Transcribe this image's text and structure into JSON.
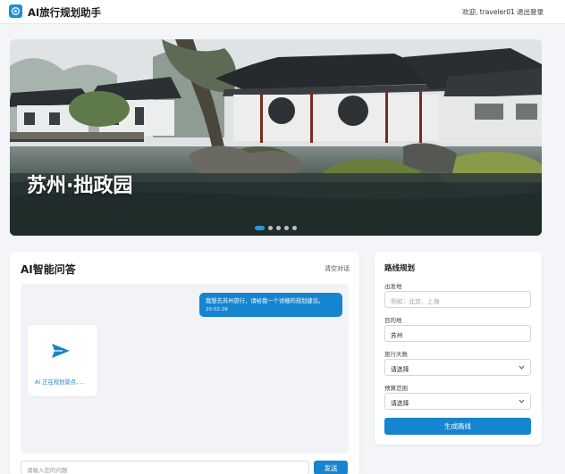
{
  "header": {
    "app_title": "AI旅行规划助手",
    "welcome_text": "欢迎, traveler01",
    "logout_label": "退出登录"
  },
  "hero": {
    "title": "苏州·拙政园",
    "carousel_total": 5,
    "carousel_active_index": 0
  },
  "chat": {
    "title": "AI智能问答",
    "clear_label": "清空对话",
    "user_message": "我想去苏州旅行，请给我一个详细的规划建议。",
    "user_time": "20:02:29",
    "ai_status": "AI 正在规划景点, ...",
    "input_placeholder": "请输入您的问题",
    "send_label": "发送"
  },
  "route": {
    "title": "路线规划",
    "departure_label": "出发地",
    "departure_placeholder": "例如：北京、上海",
    "destination_label": "目的地",
    "destination_value": "苏州",
    "days_label": "旅行天数",
    "days_value": "请选择",
    "budget_label": "预算范围",
    "budget_value": "请选择",
    "generate_label": "生成路线"
  },
  "colors": {
    "accent": "#1685cf",
    "page_bg": "#f3f5f8"
  }
}
